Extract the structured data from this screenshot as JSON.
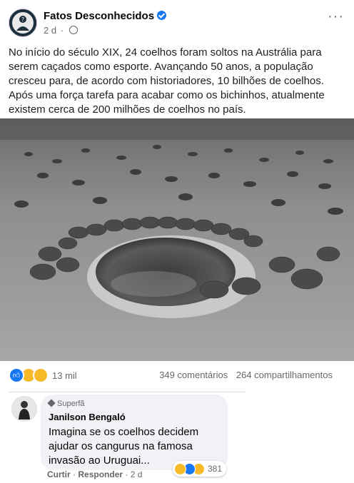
{
  "post": {
    "page_name": "Fatos Desconhecidos",
    "time": "2 d",
    "more_glyph": "···",
    "text": "No início do século XIX, 24 coelhos foram soltos na Austrália para serem caçados como esporte. Avançando 50 anos, a população cresceu para, de acordo com historiadores, 10 bilhões de coelhos. Após uma força tarefa para acabar como os bichinhos, atualmente existem cerca de 200 milhões de coelhos no país.",
    "photo_subject": "black-and-white photo of a crowd of rabbits gathered around a waterhole",
    "reaction_icons": [
      "like-icon",
      "haha-icon",
      "wow-icon"
    ],
    "reaction_count": "13 mil",
    "comments_count": "349 comentários",
    "shares_count": "264 compartilhamentos"
  },
  "comment": {
    "badge": "Superfã",
    "author": "Janilson Bengaló",
    "text": "Imagina se os coelhos decidem ajudar os cangurus na famosa invasão ao Uruguai...",
    "action_reply_share": "Curtir",
    "action_respond": "Responder",
    "time": "2 d",
    "reaction_icons": [
      "haha-icon",
      "like-icon",
      "wow-icon"
    ],
    "reaction_count": "381"
  },
  "colors": {
    "verified": "#1877f2",
    "secondary_text": "#65676b",
    "comment_bubble": "#f0f2f5"
  }
}
